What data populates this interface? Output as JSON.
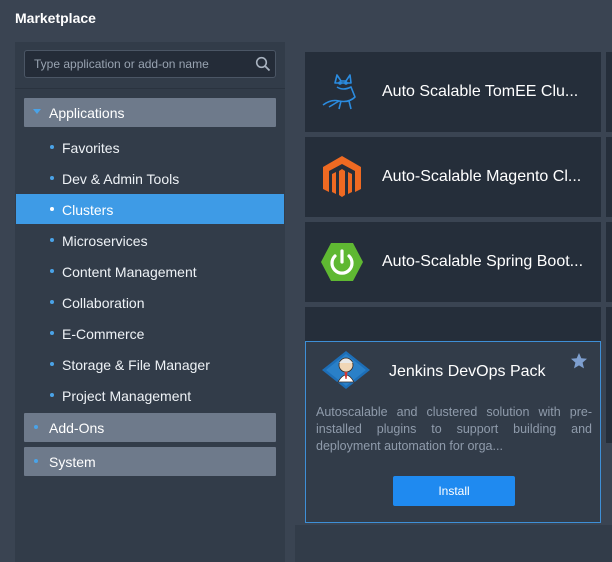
{
  "window": {
    "title": "Marketplace"
  },
  "search": {
    "placeholder": "Type application or add-on name"
  },
  "sidebar": {
    "groups": [
      {
        "label": "Applications",
        "expanded": true
      },
      {
        "label": "Add-Ons",
        "expanded": false
      },
      {
        "label": "System",
        "expanded": false
      }
    ],
    "items": [
      {
        "label": "Favorites"
      },
      {
        "label": "Dev & Admin Tools"
      },
      {
        "label": "Clusters",
        "active": true
      },
      {
        "label": "Microservices"
      },
      {
        "label": "Content Management"
      },
      {
        "label": "Collaboration"
      },
      {
        "label": "E-Commerce"
      },
      {
        "label": "Storage & File Manager"
      },
      {
        "label": "Project Management"
      }
    ]
  },
  "apps": [
    {
      "name": "Auto Scalable TomEE Clu...",
      "icon": "tomee-cat-icon"
    },
    {
      "name": "Auto-Scalable Magento Cl...",
      "icon": "magento-icon"
    },
    {
      "name": "Auto-Scalable Spring Boot...",
      "icon": "spring-power-icon"
    }
  ],
  "popup": {
    "name": "Jenkins DevOps Pack",
    "icon": "jenkins-icon",
    "description": "Autoscalable and clustered solution with pre-installed plugins to support building and deployment automation for orga...",
    "install_label": "Install",
    "favorite_icon": "star-icon"
  },
  "colors": {
    "accent": "#3e9be6",
    "install_button": "#1f8af0",
    "background": "#3a4452",
    "card": "#252e3a"
  }
}
